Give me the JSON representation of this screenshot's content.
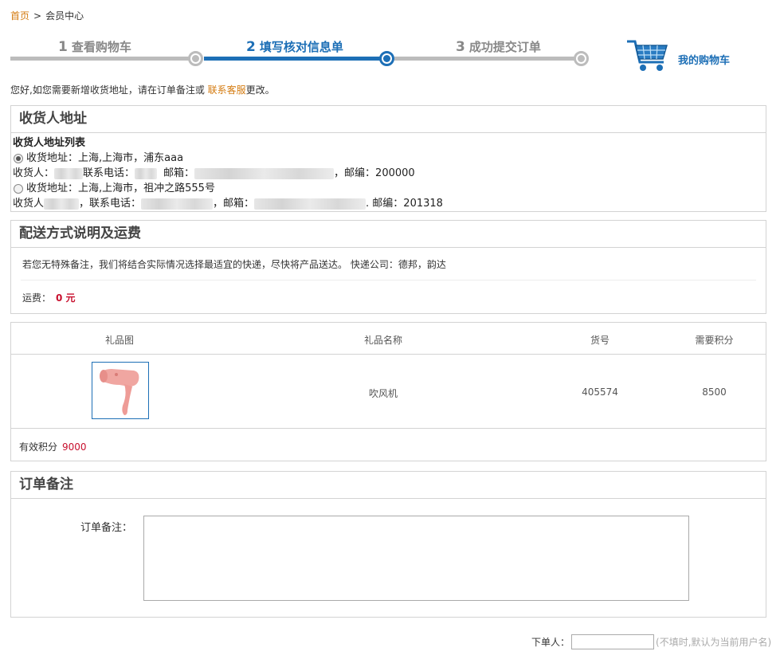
{
  "breadcrumb": {
    "home": "首页",
    "separator": ">",
    "current": "会员中心"
  },
  "steps": [
    {
      "num": "1",
      "label": "查看购物车",
      "state": "done"
    },
    {
      "num": "2",
      "label": "填写核对信息单",
      "state": "active"
    },
    {
      "num": "3",
      "label": "成功提交订单",
      "state": "pending"
    }
  ],
  "cart": {
    "label": "我的购物车",
    "icon": "shopping-cart-icon"
  },
  "notice": {
    "before": "您好,如您需要新增收货地址，请在订单备注或 ",
    "link": "联系客服",
    "after": "更改。"
  },
  "address": {
    "title": "收货人地址",
    "list_title": "收货人地址列表",
    "entries": [
      {
        "checked": true,
        "addr_line": "收货地址：上海,上海市，浦东aaa",
        "consignee_label": "收货人：",
        "phone_label": "联系电话：",
        "email_label": "邮箱：",
        "zip_label": "，邮编：200000"
      },
      {
        "checked": false,
        "addr_line": "收货地址：上海,上海市，祖冲之路555号",
        "consignee_label": "收货人",
        "phone_label": "，联系电话：",
        "email_label": "，邮箱：",
        "zip_label": ". 邮编：201318"
      }
    ]
  },
  "shipping": {
    "title": "配送方式说明及运费",
    "description": "若您无特殊备注，我们将结合实际情况选择最适宜的快递，尽快将产品送达。 快递公司：德邦，韵达",
    "fee_label": "运费：",
    "fee_value": "0 元"
  },
  "gifts": {
    "headers": [
      "礼品图",
      "礼品名称",
      "货号",
      "需要积分"
    ],
    "rows": [
      {
        "image": "hair-dryer-image",
        "name": "吹风机",
        "sku": "405574",
        "points": "8500"
      }
    ],
    "valid_points_label": "有效积分",
    "valid_points_value": "9000"
  },
  "remark": {
    "title": "订单备注",
    "label": "订单备注：",
    "value": ""
  },
  "orderer": {
    "label": "下单人：",
    "value": "",
    "hint": "(不填时,默认为当前用户名)"
  },
  "colors": {
    "accent_blue": "#1d6fb6",
    "link_orange": "#d47b10",
    "price_red": "#c8102e",
    "inactive_gray": "#bcbcbc"
  }
}
